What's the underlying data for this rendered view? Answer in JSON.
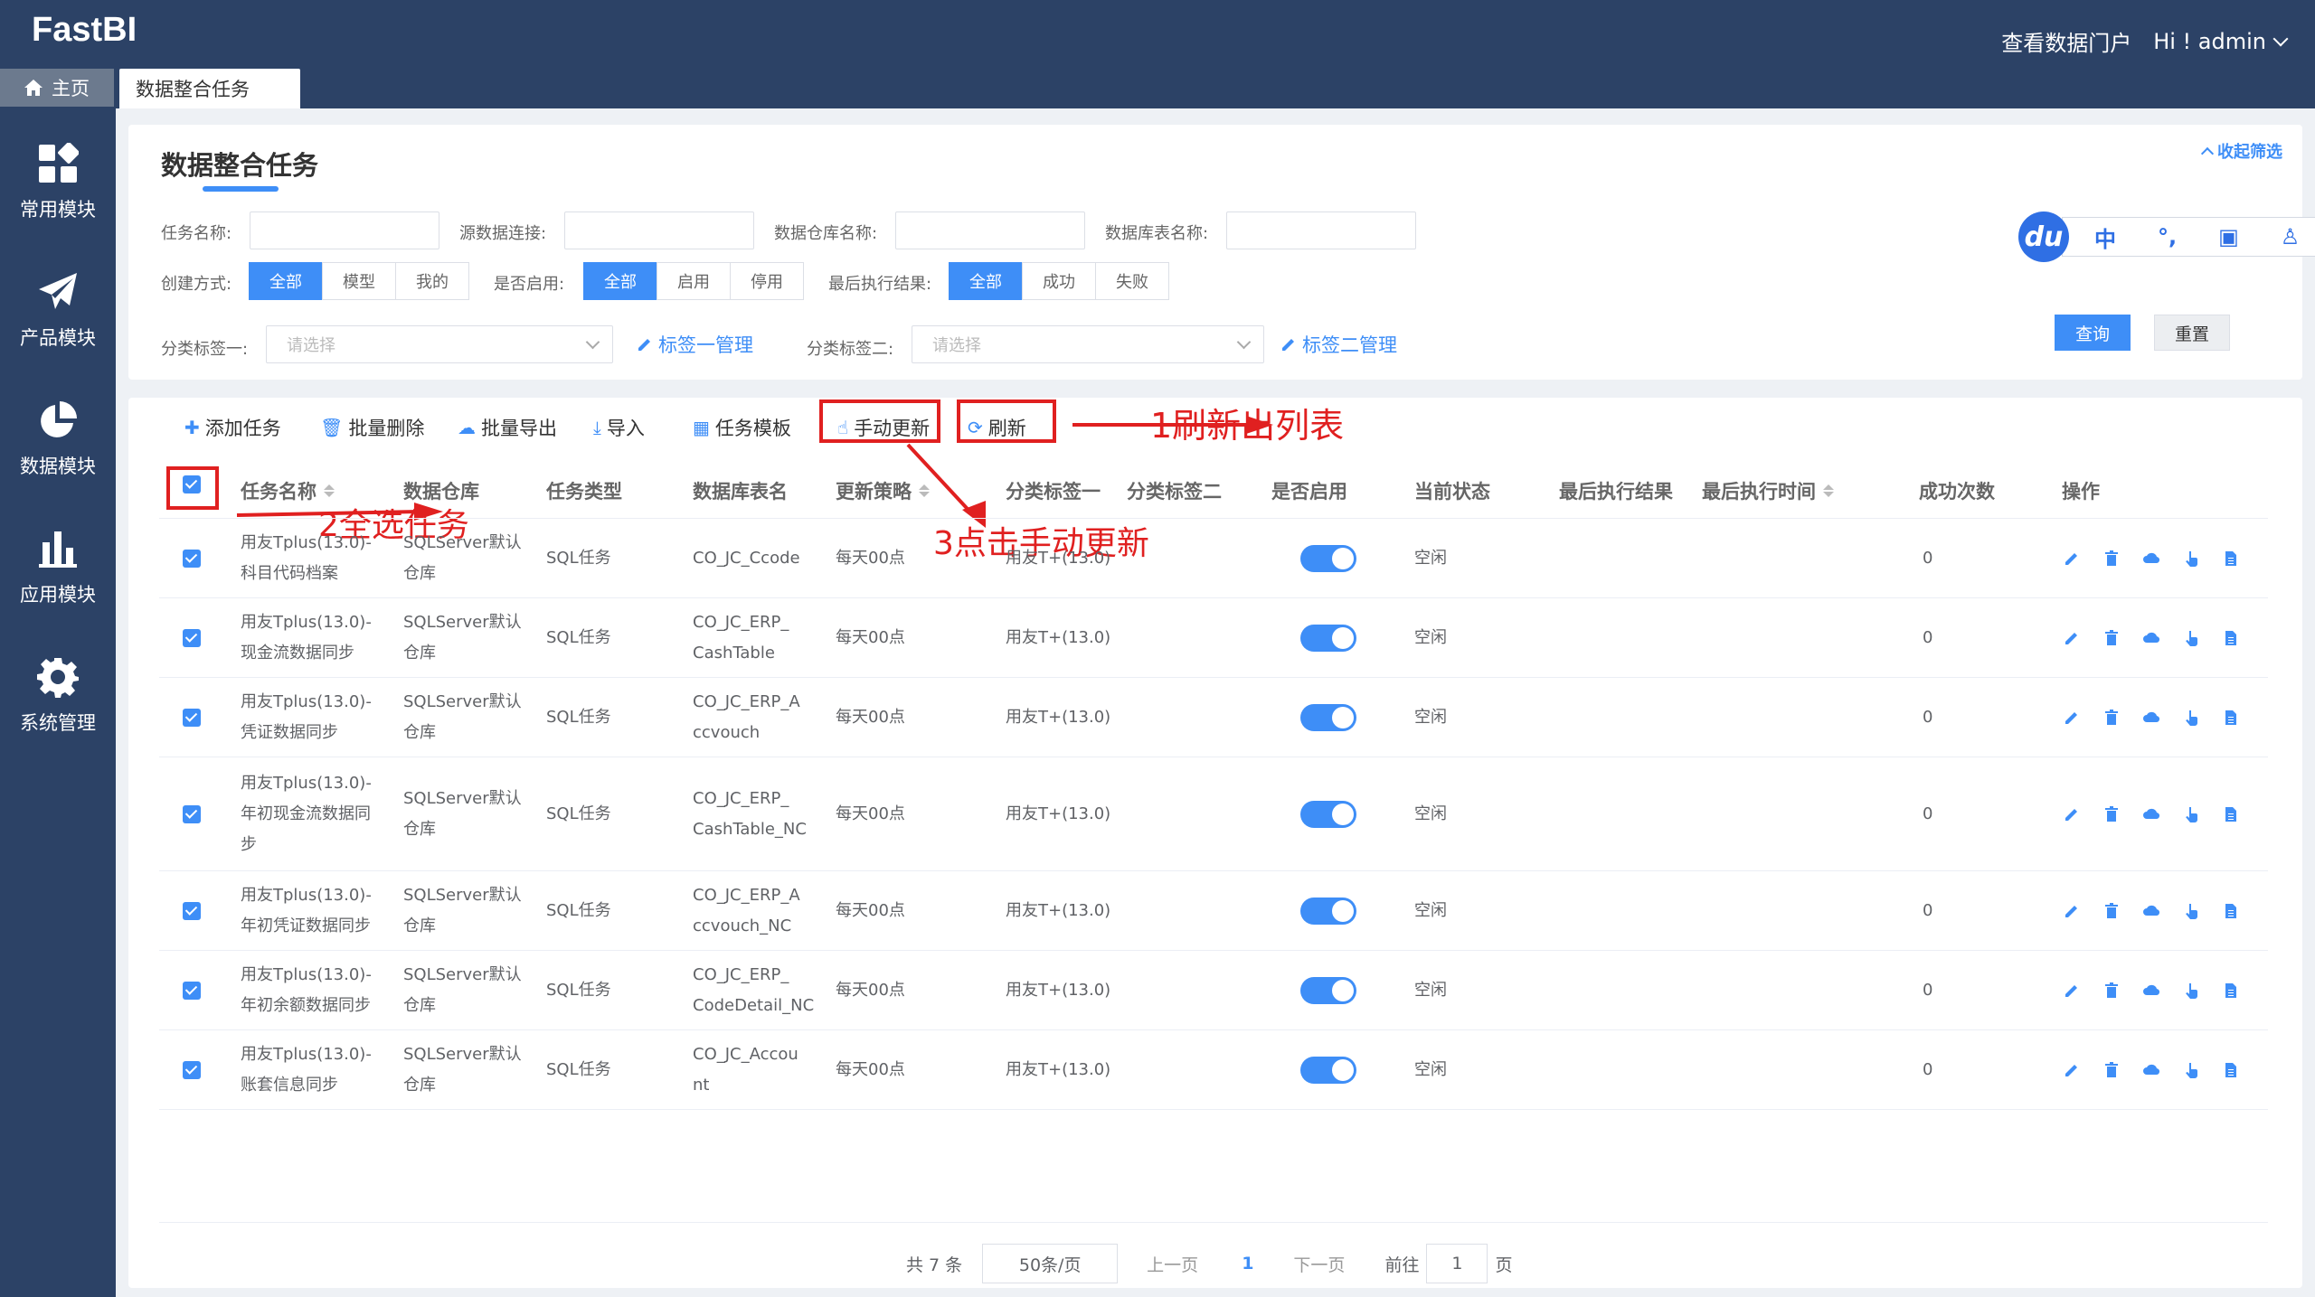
{
  "app": {
    "logo": "FastBI",
    "portal_link": "查看数据门户",
    "user": "Hi ! admin"
  },
  "tabs": {
    "home": "主页",
    "active": "数据整合任务"
  },
  "sidebar": {
    "items": [
      {
        "label": "常用模块",
        "icon": "grid-icon"
      },
      {
        "label": "产品模块",
        "icon": "paper-plane-icon"
      },
      {
        "label": "数据模块",
        "icon": "pie-chart-icon"
      },
      {
        "label": "应用模块",
        "icon": "bar-chart-icon"
      },
      {
        "label": "系统管理",
        "icon": "gear-icon"
      }
    ]
  },
  "filters": {
    "page_title": "数据整合任务",
    "collapse_label": "收起筛选",
    "task_name_label": "任务名称:",
    "source_conn_label": "源数据连接:",
    "warehouse_label": "数据仓库名称:",
    "db_table_label": "数据库表名称:",
    "create_mode_label": "创建方式:",
    "create_mode_options": [
      "全部",
      "模型",
      "我的"
    ],
    "enabled_label": "是否启用:",
    "enabled_options": [
      "全部",
      "启用",
      "停用"
    ],
    "last_result_label": "最后执行结果:",
    "last_result_options": [
      "全部",
      "成功",
      "失败"
    ],
    "tag1_label": "分类标签一:",
    "tag1_placeholder": "请选择",
    "tag1_manage": "标签一管理",
    "tag2_label": "分类标签二:",
    "tag2_placeholder": "请选择",
    "tag2_manage": "标签二管理",
    "query_button": "查询",
    "reset_button": "重置",
    "ime_logo": "du",
    "ime_lang": "中"
  },
  "toolbar": {
    "add": "添加任务",
    "batch_delete": "批量删除",
    "batch_export": "批量导出",
    "import": "导入",
    "template": "任务模板",
    "manual_update": "手动更新",
    "refresh": "刷新"
  },
  "annotations": {
    "a1": "1刷新出列表",
    "a2": "2全选任务",
    "a3": "3点击手动更新"
  },
  "table": {
    "headers": {
      "name": "任务名称",
      "warehouse": "数据仓库",
      "type": "任务类型",
      "db_table": "数据库表名",
      "strategy": "更新策略",
      "tag1": "分类标签一",
      "tag2": "分类标签二",
      "enabled": "是否启用",
      "state": "当前状态",
      "last_result": "最后执行结果",
      "last_time": "最后执行时间",
      "success_count": "成功次数",
      "ops": "操作"
    },
    "rows": [
      {
        "name": [
          "用友Tplus(13.0)-",
          "科目代码档案"
        ],
        "warehouse": [
          "SQLServer默认",
          "仓库"
        ],
        "type": "SQL任务",
        "db_table": [
          "CO_JC_Ccode"
        ],
        "strategy": "每天00点",
        "tag1": "用友T+(13.0)",
        "state": "空闲",
        "success": "0"
      },
      {
        "name": [
          "用友Tplus(13.0)-",
          "现金流数据同步"
        ],
        "warehouse": [
          "SQLServer默认",
          "仓库"
        ],
        "type": "SQL任务",
        "db_table": [
          "CO_JC_ERP_",
          "CashTable"
        ],
        "strategy": "每天00点",
        "tag1": "用友T+(13.0)",
        "state": "空闲",
        "success": "0"
      },
      {
        "name": [
          "用友Tplus(13.0)-",
          "凭证数据同步"
        ],
        "warehouse": [
          "SQLServer默认",
          "仓库"
        ],
        "type": "SQL任务",
        "db_table": [
          "CO_JC_ERP_A",
          "ccvouch"
        ],
        "strategy": "每天00点",
        "tag1": "用友T+(13.0)",
        "state": "空闲",
        "success": "0"
      },
      {
        "name": [
          "用友Tplus(13.0)-",
          "年初现金流数据同",
          "步"
        ],
        "warehouse": [
          "SQLServer默认",
          "仓库"
        ],
        "type": "SQL任务",
        "db_table": [
          "CO_JC_ERP_",
          "CashTable_NC"
        ],
        "strategy": "每天00点",
        "tag1": "用友T+(13.0)",
        "state": "空闲",
        "success": "0"
      },
      {
        "name": [
          "用友Tplus(13.0)-",
          "年初凭证数据同步"
        ],
        "warehouse": [
          "SQLServer默认",
          "仓库"
        ],
        "type": "SQL任务",
        "db_table": [
          "CO_JC_ERP_A",
          "ccvouch_NC"
        ],
        "strategy": "每天00点",
        "tag1": "用友T+(13.0)",
        "state": "空闲",
        "success": "0"
      },
      {
        "name": [
          "用友Tplus(13.0)-",
          "年初余额数据同步"
        ],
        "warehouse": [
          "SQLServer默认",
          "仓库"
        ],
        "type": "SQL任务",
        "db_table": [
          "CO_JC_ERP_",
          "CodeDetail_NC"
        ],
        "strategy": "每天00点",
        "tag1": "用友T+(13.0)",
        "state": "空闲",
        "success": "0"
      },
      {
        "name": [
          "用友Tplus(13.0)-",
          "账套信息同步"
        ],
        "warehouse": [
          "SQLServer默认",
          "仓库"
        ],
        "type": "SQL任务",
        "db_table": [
          "CO_JC_Accou",
          "nt"
        ],
        "strategy": "每天00点",
        "tag1": "用友T+(13.0)",
        "state": "空闲",
        "success": "0"
      }
    ]
  },
  "pagination": {
    "total": "共 7 条",
    "page_size": "50条/页",
    "prev": "上一页",
    "current": "1",
    "next": "下一页",
    "goto_label": "前往",
    "goto_value": "1",
    "page_suffix": "页"
  },
  "colors": {
    "header_bg": "#2c4266",
    "accent": "#3e8ef7",
    "annotation": "#e02020"
  }
}
